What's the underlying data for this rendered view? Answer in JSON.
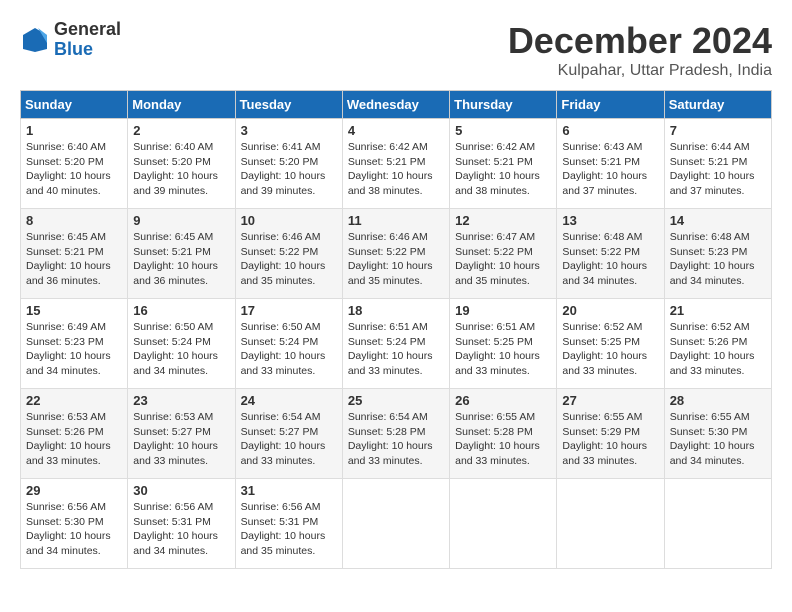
{
  "logo": {
    "general": "General",
    "blue": "Blue"
  },
  "title": "December 2024",
  "location": "Kulpahar, Uttar Pradesh, India",
  "headers": [
    "Sunday",
    "Monday",
    "Tuesday",
    "Wednesday",
    "Thursday",
    "Friday",
    "Saturday"
  ],
  "weeks": [
    [
      {
        "day": "1",
        "sunrise": "Sunrise: 6:40 AM",
        "sunset": "Sunset: 5:20 PM",
        "daylight": "Daylight: 10 hours and 40 minutes."
      },
      {
        "day": "2",
        "sunrise": "Sunrise: 6:40 AM",
        "sunset": "Sunset: 5:20 PM",
        "daylight": "Daylight: 10 hours and 39 minutes."
      },
      {
        "day": "3",
        "sunrise": "Sunrise: 6:41 AM",
        "sunset": "Sunset: 5:20 PM",
        "daylight": "Daylight: 10 hours and 39 minutes."
      },
      {
        "day": "4",
        "sunrise": "Sunrise: 6:42 AM",
        "sunset": "Sunset: 5:21 PM",
        "daylight": "Daylight: 10 hours and 38 minutes."
      },
      {
        "day": "5",
        "sunrise": "Sunrise: 6:42 AM",
        "sunset": "Sunset: 5:21 PM",
        "daylight": "Daylight: 10 hours and 38 minutes."
      },
      {
        "day": "6",
        "sunrise": "Sunrise: 6:43 AM",
        "sunset": "Sunset: 5:21 PM",
        "daylight": "Daylight: 10 hours and 37 minutes."
      },
      {
        "day": "7",
        "sunrise": "Sunrise: 6:44 AM",
        "sunset": "Sunset: 5:21 PM",
        "daylight": "Daylight: 10 hours and 37 minutes."
      }
    ],
    [
      {
        "day": "8",
        "sunrise": "Sunrise: 6:45 AM",
        "sunset": "Sunset: 5:21 PM",
        "daylight": "Daylight: 10 hours and 36 minutes."
      },
      {
        "day": "9",
        "sunrise": "Sunrise: 6:45 AM",
        "sunset": "Sunset: 5:21 PM",
        "daylight": "Daylight: 10 hours and 36 minutes."
      },
      {
        "day": "10",
        "sunrise": "Sunrise: 6:46 AM",
        "sunset": "Sunset: 5:22 PM",
        "daylight": "Daylight: 10 hours and 35 minutes."
      },
      {
        "day": "11",
        "sunrise": "Sunrise: 6:46 AM",
        "sunset": "Sunset: 5:22 PM",
        "daylight": "Daylight: 10 hours and 35 minutes."
      },
      {
        "day": "12",
        "sunrise": "Sunrise: 6:47 AM",
        "sunset": "Sunset: 5:22 PM",
        "daylight": "Daylight: 10 hours and 35 minutes."
      },
      {
        "day": "13",
        "sunrise": "Sunrise: 6:48 AM",
        "sunset": "Sunset: 5:22 PM",
        "daylight": "Daylight: 10 hours and 34 minutes."
      },
      {
        "day": "14",
        "sunrise": "Sunrise: 6:48 AM",
        "sunset": "Sunset: 5:23 PM",
        "daylight": "Daylight: 10 hours and 34 minutes."
      }
    ],
    [
      {
        "day": "15",
        "sunrise": "Sunrise: 6:49 AM",
        "sunset": "Sunset: 5:23 PM",
        "daylight": "Daylight: 10 hours and 34 minutes."
      },
      {
        "day": "16",
        "sunrise": "Sunrise: 6:50 AM",
        "sunset": "Sunset: 5:24 PM",
        "daylight": "Daylight: 10 hours and 34 minutes."
      },
      {
        "day": "17",
        "sunrise": "Sunrise: 6:50 AM",
        "sunset": "Sunset: 5:24 PM",
        "daylight": "Daylight: 10 hours and 33 minutes."
      },
      {
        "day": "18",
        "sunrise": "Sunrise: 6:51 AM",
        "sunset": "Sunset: 5:24 PM",
        "daylight": "Daylight: 10 hours and 33 minutes."
      },
      {
        "day": "19",
        "sunrise": "Sunrise: 6:51 AM",
        "sunset": "Sunset: 5:25 PM",
        "daylight": "Daylight: 10 hours and 33 minutes."
      },
      {
        "day": "20",
        "sunrise": "Sunrise: 6:52 AM",
        "sunset": "Sunset: 5:25 PM",
        "daylight": "Daylight: 10 hours and 33 minutes."
      },
      {
        "day": "21",
        "sunrise": "Sunrise: 6:52 AM",
        "sunset": "Sunset: 5:26 PM",
        "daylight": "Daylight: 10 hours and 33 minutes."
      }
    ],
    [
      {
        "day": "22",
        "sunrise": "Sunrise: 6:53 AM",
        "sunset": "Sunset: 5:26 PM",
        "daylight": "Daylight: 10 hours and 33 minutes."
      },
      {
        "day": "23",
        "sunrise": "Sunrise: 6:53 AM",
        "sunset": "Sunset: 5:27 PM",
        "daylight": "Daylight: 10 hours and 33 minutes."
      },
      {
        "day": "24",
        "sunrise": "Sunrise: 6:54 AM",
        "sunset": "Sunset: 5:27 PM",
        "daylight": "Daylight: 10 hours and 33 minutes."
      },
      {
        "day": "25",
        "sunrise": "Sunrise: 6:54 AM",
        "sunset": "Sunset: 5:28 PM",
        "daylight": "Daylight: 10 hours and 33 minutes."
      },
      {
        "day": "26",
        "sunrise": "Sunrise: 6:55 AM",
        "sunset": "Sunset: 5:28 PM",
        "daylight": "Daylight: 10 hours and 33 minutes."
      },
      {
        "day": "27",
        "sunrise": "Sunrise: 6:55 AM",
        "sunset": "Sunset: 5:29 PM",
        "daylight": "Daylight: 10 hours and 33 minutes."
      },
      {
        "day": "28",
        "sunrise": "Sunrise: 6:55 AM",
        "sunset": "Sunset: 5:30 PM",
        "daylight": "Daylight: 10 hours and 34 minutes."
      }
    ],
    [
      {
        "day": "29",
        "sunrise": "Sunrise: 6:56 AM",
        "sunset": "Sunset: 5:30 PM",
        "daylight": "Daylight: 10 hours and 34 minutes."
      },
      {
        "day": "30",
        "sunrise": "Sunrise: 6:56 AM",
        "sunset": "Sunset: 5:31 PM",
        "daylight": "Daylight: 10 hours and 34 minutes."
      },
      {
        "day": "31",
        "sunrise": "Sunrise: 6:56 AM",
        "sunset": "Sunset: 5:31 PM",
        "daylight": "Daylight: 10 hours and 35 minutes."
      },
      null,
      null,
      null,
      null
    ]
  ]
}
